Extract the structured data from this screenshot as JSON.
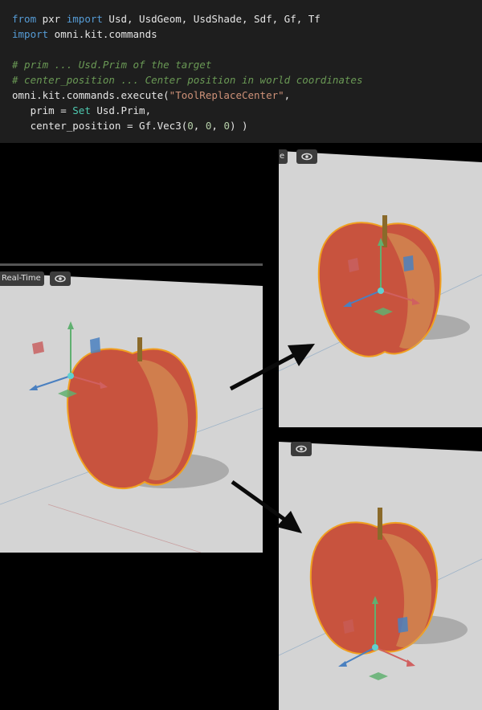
{
  "code": {
    "lines": [
      [
        {
          "t": "from",
          "c": "kw"
        },
        {
          "t": " pxr "
        },
        {
          "t": "import",
          "c": "kw"
        },
        {
          "t": " Usd, UsdGeom, UsdShade, Sdf, Gf, Tf"
        }
      ],
      [
        {
          "t": "import",
          "c": "kw"
        },
        {
          "t": " omni.kit.commands"
        }
      ],
      [],
      [
        {
          "t": "# prim ... Usd.Prim of the target",
          "c": "cm"
        }
      ],
      [
        {
          "t": "# center_position ... Center position in world coordinates",
          "c": "cm"
        }
      ],
      [
        {
          "t": "omni.kit.commands.execute("
        },
        {
          "t": "\"ToolReplaceCenter\"",
          "c": "st"
        },
        {
          "t": ","
        }
      ],
      [
        {
          "t": "   prim = "
        },
        {
          "t": "Set",
          "c": "ty"
        },
        {
          "t": " Usd.Prim,"
        }
      ],
      [
        {
          "t": "   center_position = Gf.Vec3("
        },
        {
          "t": "0",
          "c": "nm"
        },
        {
          "t": ", "
        },
        {
          "t": "0",
          "c": "nm"
        },
        {
          "t": ", "
        },
        {
          "t": "0",
          "c": "nm"
        },
        {
          "t": ") )"
        }
      ]
    ]
  },
  "viewports": {
    "left": {
      "label": "Real-Time",
      "eye_icon": "eye-icon"
    },
    "top_right": {
      "label": "e",
      "eye_icon": "eye-icon"
    },
    "bottom_right": {
      "label": "",
      "eye_icon": "eye-icon"
    }
  },
  "colors": {
    "code_bg": "#1e1e1e",
    "viewport_bg": "#d3d3d3",
    "selection_outline": "#f0a020",
    "axis_x": "#d06060",
    "axis_y": "#60b070",
    "axis_z": "#4a80c0",
    "pivot": "#60d0d0"
  }
}
